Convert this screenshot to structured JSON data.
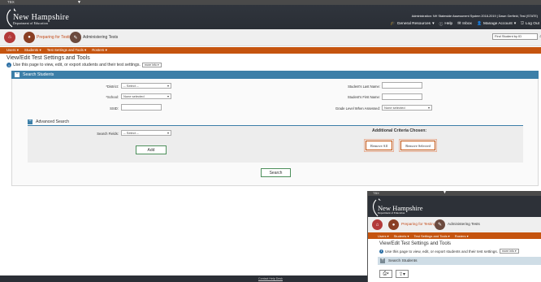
{
  "window": {
    "title": "TBX"
  },
  "header": {
    "brand_line1": "New Hampshire",
    "brand_line2": "Department of Education",
    "user_line": "Administration: NH Statewide Assessment System 2018-2019  |  Dawn Gerfield, Test (STATE)",
    "utility": {
      "general_resources": "General Resources",
      "help": "Help",
      "inbox": "Inbox",
      "manage_account": "Manage Account",
      "log_out": "Log Out"
    }
  },
  "appbar": {
    "preparing": "Preparing for Testing",
    "administering": "Administering Tests",
    "find_student": "Find Student by ID"
  },
  "nav": {
    "users": "Users",
    "students": "Students",
    "test_settings": "Test Settings and Tools",
    "rosters": "Rosters"
  },
  "page": {
    "title": "View/Edit Test Settings and Tools",
    "info": "Use this page to view, edit, or export students and their test settings.",
    "more_info": "more info"
  },
  "search": {
    "panel_title": "Search Students",
    "district_label": "*District:",
    "district_value": "-- Select --",
    "school_label": "*School:",
    "school_value": "None selected",
    "ssid_label": "SSID:",
    "last_name_label": "Student's Last Name:",
    "first_name_label": "Student's First Name:",
    "grade_label": "Grade Level When Assessed:",
    "grade_value": "None selected",
    "advanced_title": "Advanced Search",
    "search_fields_label": "Search Fields:",
    "search_fields_value": "-- Select --",
    "add_button": "Add",
    "criteria_title": "Additional Criteria Chosen:",
    "remove_all": "Remove All",
    "remove_selected": "Remove Selected",
    "search_button": "Search"
  },
  "footer": {
    "contact": "Contact Help Desk"
  },
  "window2": {
    "title": "TBX",
    "brand_line1": "New Hampshire",
    "brand_line2": "Department of Education",
    "preparing": "Preparing for Testing",
    "administering": "Administering Tests",
    "nav_users": "Users",
    "nav_students": "Students",
    "nav_test_settings": "Test Settings and Tools",
    "nav_rosters": "Rosters",
    "page_title": "View/Edit Test Settings and Tools",
    "page_info": "Use this page to view, edit, or export students and their test settings.",
    "more_info": "more info",
    "panel_title": "Search Students"
  },
  "colors": {
    "header_bg": "#2b2f36",
    "nav_orange": "#c5540f",
    "panel_blue": "#3c7fa8",
    "add_green": "#4d8f5b"
  }
}
